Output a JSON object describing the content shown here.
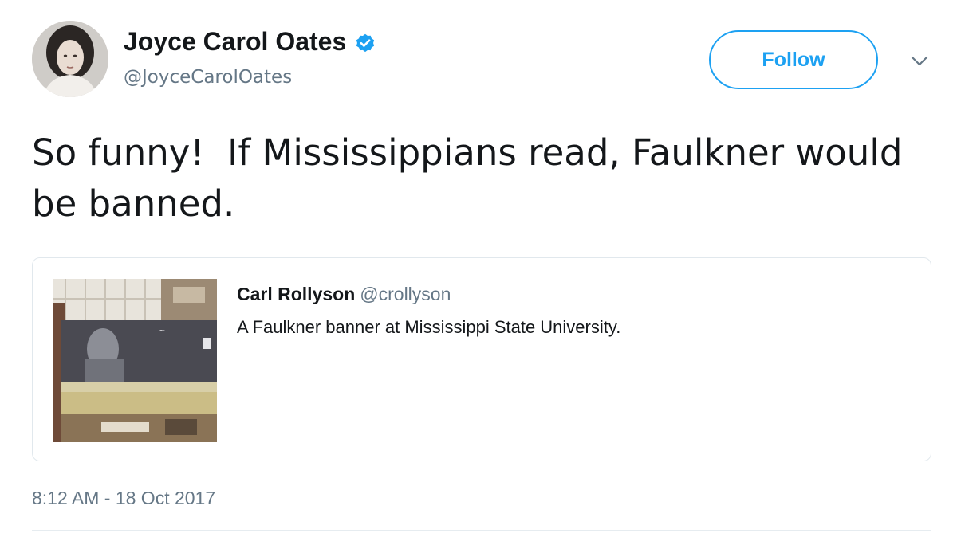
{
  "author": {
    "name": "Joyce Carol Oates",
    "handle": "@JoyceCarolOates",
    "verified": true
  },
  "follow_button": {
    "label": "Follow"
  },
  "tweet": {
    "text": "So funny!  If Mississippians read, Faulkner would be banned.",
    "timestamp": "8:12 AM - 18 Oct 2017"
  },
  "quoted_tweet": {
    "author_name": "Carl Rollyson",
    "author_handle": "@crollyson",
    "text": "A Faulkner banner at Mississippi State University."
  },
  "colors": {
    "accent": "#1da1f2",
    "text": "#14171a",
    "muted": "#657786",
    "border": "#e1e8ed"
  },
  "icons": [
    "verified-badge-icon",
    "chevron-down-icon"
  ]
}
